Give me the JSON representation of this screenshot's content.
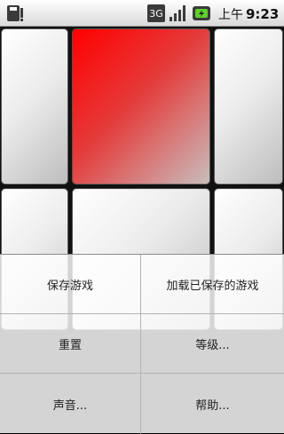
{
  "status_bar": {
    "network_type": "3G",
    "ampm": "上午",
    "time": "9:23"
  },
  "board": {
    "active_tile_color": "#ff0000",
    "tile_color": "#ffffff"
  },
  "menu": {
    "items": [
      {
        "label": "保存游戏"
      },
      {
        "label": "加载已保存的游戏"
      },
      {
        "label": "重置"
      },
      {
        "label": "等级..."
      },
      {
        "label": "声音..."
      },
      {
        "label": "帮助..."
      }
    ]
  }
}
